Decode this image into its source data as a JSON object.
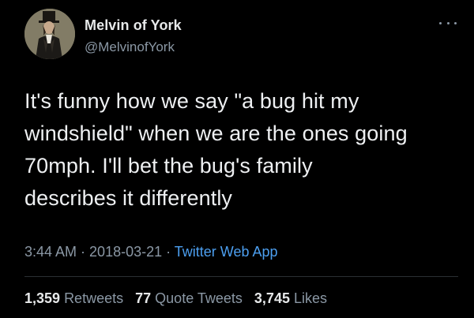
{
  "author": {
    "name": "Melvin of York",
    "handle": "@MelvinofYork",
    "avatar_icon": "portrait-avatar"
  },
  "more_icon": "ellipsis-icon",
  "tweet": {
    "lines": [
      "It's funny how we say \"a bug hit my",
      "windshield\" when we are the ones going",
      "70mph. I'll bet the bug's family",
      "describes it differently"
    ]
  },
  "meta": {
    "time": "3:44 AM",
    "sep1": " · ",
    "date": "2018-03-21",
    "sep2": " · ",
    "app": "Twitter Web App"
  },
  "stats": {
    "retweets_count": "1,359",
    "retweets_label": "Retweets",
    "quotes_count": "77",
    "quotes_label": "Quote Tweets",
    "likes_count": "3,745",
    "likes_label": "Likes"
  },
  "colors": {
    "background": "#000000",
    "text": "#e7e9ea",
    "secondary": "#8b98a5",
    "link": "#4c9ff0"
  }
}
